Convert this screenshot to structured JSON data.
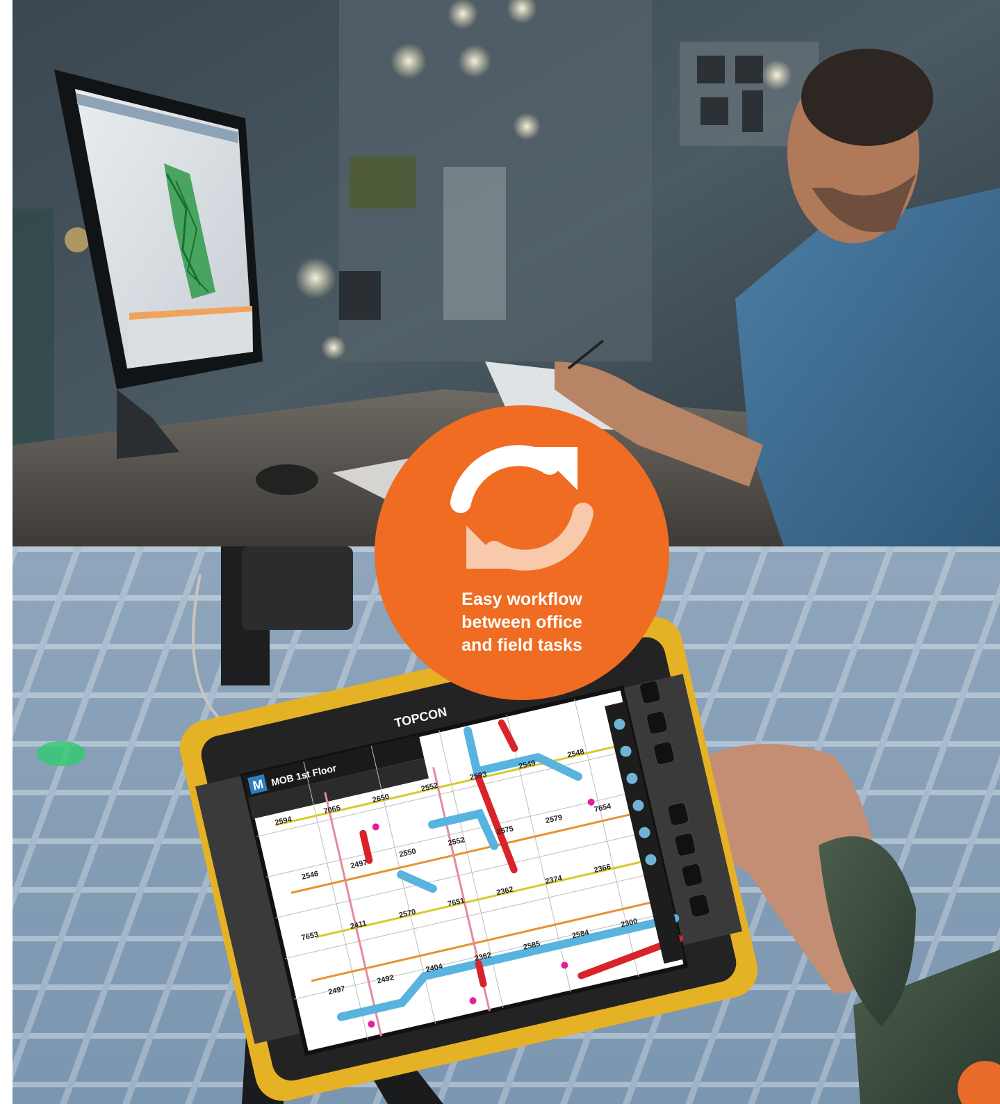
{
  "badge": {
    "icon": "sync-arrows-icon",
    "line1": "Easy workflow",
    "line2": "between office",
    "line3": "and field tasks",
    "background_color": "#ef6c22",
    "text_color": "#ffffff"
  },
  "tablet": {
    "brand": "TOPCON",
    "app_badge": "M",
    "project_title": "MOB 1st Floor",
    "plan_labels": [
      "2594",
      "7065",
      "2650",
      "2552",
      "2593",
      "2549",
      "2548",
      "2546",
      "2497",
      "2550",
      "2552",
      "2575",
      "2579",
      "7654",
      "7653",
      "2411",
      "2570",
      "7651",
      "2362",
      "2374",
      "2366",
      "2497",
      "2492",
      "2404",
      "2362",
      "2585",
      "2584",
      "2300"
    ]
  },
  "colors": {
    "bumper": "#e5b125",
    "device_body": "#232323",
    "duct_blue": "#58b3de",
    "duct_red": "#d8232a"
  }
}
